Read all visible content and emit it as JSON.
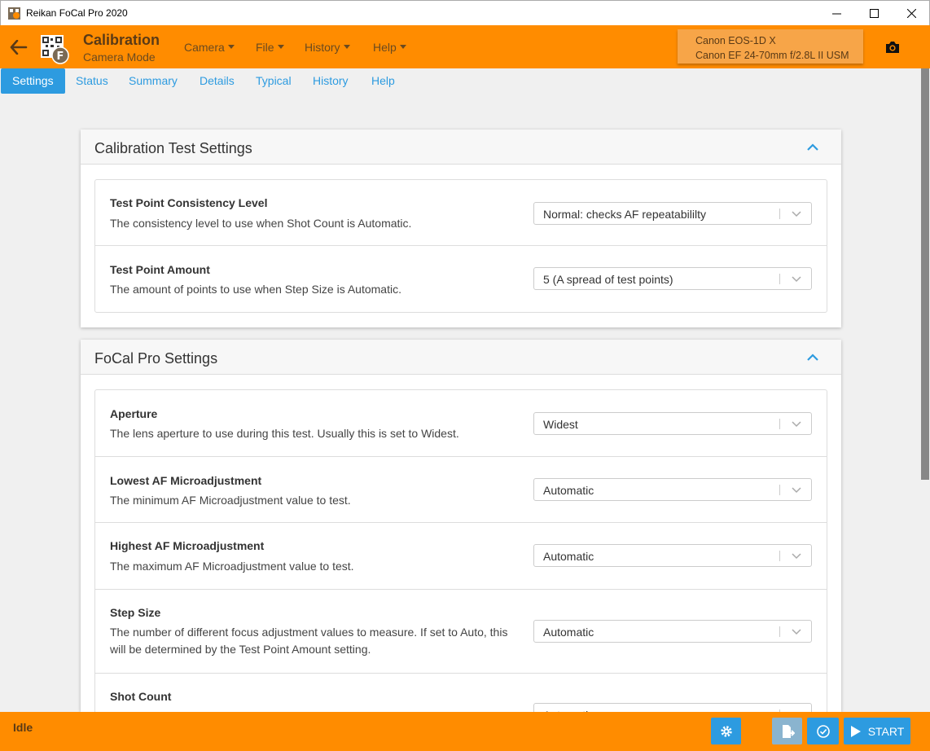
{
  "window": {
    "title": "Reikan FoCal Pro 2020"
  },
  "header": {
    "title": "Calibration",
    "subtitle": "Camera Mode",
    "menus": [
      "Camera",
      "File",
      "History",
      "Help"
    ],
    "camera_body": "Canon EOS-1D X",
    "camera_lens": "Canon EF 24-70mm f/2.8L II USM"
  },
  "tabs": [
    "Settings",
    "Status",
    "Summary",
    "Details",
    "Typical",
    "History",
    "Help"
  ],
  "sections": {
    "calibration": {
      "title": "Calibration Test Settings",
      "rows": [
        {
          "label": "Test Point Consistency Level",
          "desc": "The consistency level to use when Shot Count is Automatic.",
          "value": "Normal: checks AF repeatabililty"
        },
        {
          "label": "Test Point Amount",
          "desc": "The amount of points to use when Step Size is Automatic.",
          "value": "5 (A spread of test points)"
        }
      ]
    },
    "focal": {
      "title": "FoCal Pro Settings",
      "rows": [
        {
          "label": "Aperture",
          "desc": "The lens aperture to use during this test. Usually this is set to Widest.",
          "value": "Widest"
        },
        {
          "label": "Lowest AF Microadjustment",
          "desc": "The minimum AF Microadjustment value to test.",
          "value": "Automatic"
        },
        {
          "label": "Highest AF Microadjustment",
          "desc": "The maximum AF Microadjustment value to test.",
          "value": "Automatic"
        },
        {
          "label": "Step Size",
          "desc": "The number of different focus adjustment values to measure. If set to Auto, this will be determined by the Test Point Amount setting.",
          "value": "Automatic"
        },
        {
          "label": "Shot Count",
          "desc": "",
          "value": "Automatic"
        }
      ]
    }
  },
  "statusbar": {
    "status": "Idle",
    "start_label": "START"
  }
}
